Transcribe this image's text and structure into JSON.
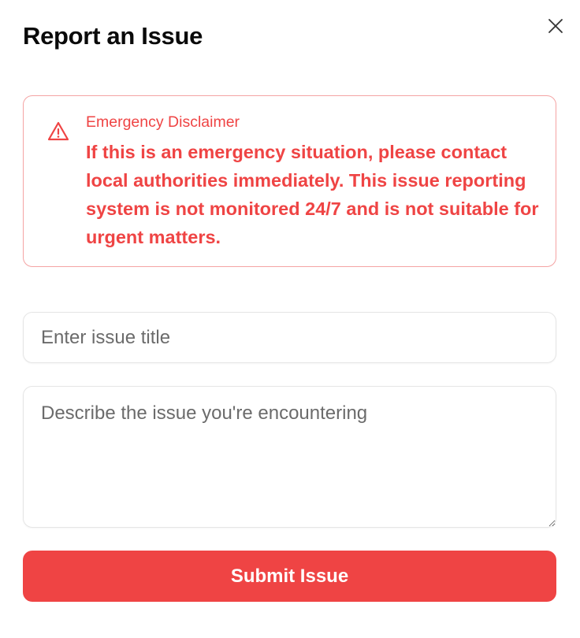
{
  "dialog": {
    "title": "Report an Issue",
    "close_icon": "close-icon"
  },
  "alert": {
    "icon": "warning-triangle-icon",
    "heading": "Emergency Disclaimer",
    "body": "If this is an emergency situation, please contact local authorities immediately. This issue reporting system is not monitored 24/7 and is not suitable for urgent matters."
  },
  "form": {
    "title_value": "",
    "title_placeholder": "Enter issue title",
    "description_value": "",
    "description_placeholder": "Describe the issue you're encountering",
    "submit_label": "Submit Issue"
  },
  "colors": {
    "accent": "#ef4444",
    "alert_border": "#f4a3a3",
    "text": "#0a0a0a",
    "placeholder": "#6b6b6b",
    "input_border": "#e5e5e5"
  }
}
